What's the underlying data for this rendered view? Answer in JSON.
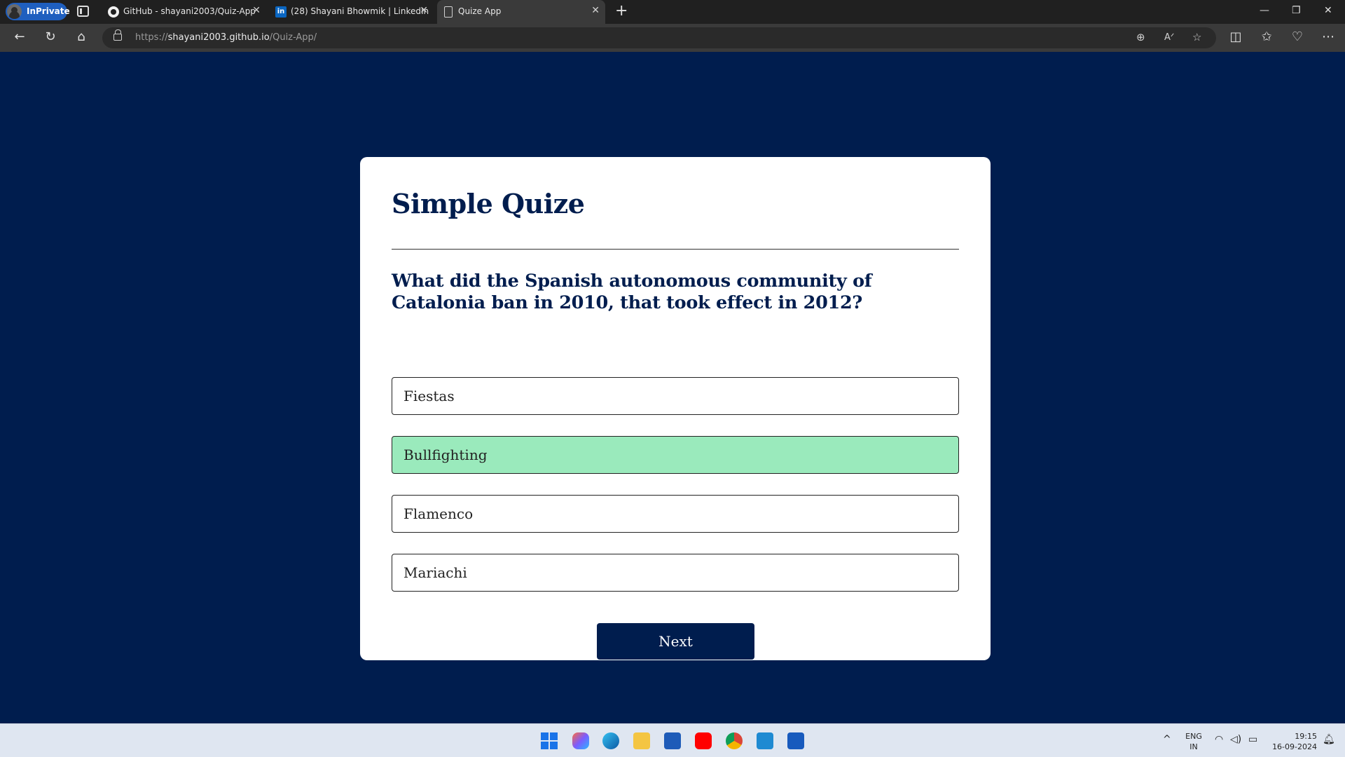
{
  "browser": {
    "inprivate_label": "InPrivate",
    "tabs": [
      {
        "title": "GitHub - shayani2003/Quiz-App",
        "icon": "github-icon"
      },
      {
        "title": "(28) Shayani Bhowmik | LinkedIn",
        "icon": "linkedin-icon",
        "icon_text": "in"
      },
      {
        "title": "Quize App",
        "icon": "page-icon"
      }
    ],
    "url_scheme": "https://",
    "url_host": "shayani2003.github.io",
    "url_path": "/Quiz-App/"
  },
  "quiz": {
    "title": "Simple Quize",
    "question": "What did the Spanish autonomous community of Catalonia ban in 2010, that took effect in 2012?",
    "answers": [
      "Fiestas",
      "Bullfighting",
      "Flamenco",
      "Mariachi"
    ],
    "correct_answer": "Bullfighting",
    "next_label": "Next"
  },
  "colors": {
    "page_background": "#001d4e",
    "card_background": "#ffffff",
    "correct_answer": "#9aeabc",
    "button": "#001d4e"
  },
  "taskbar": {
    "lang_primary": "ENG",
    "lang_secondary": "IN",
    "time": "19:15",
    "date": "16-09-2024",
    "apps": [
      "windows-start-icon",
      "copilot-icon",
      "edge-icon",
      "file-explorer-icon",
      "store-icon",
      "youtube-icon",
      "chrome-icon",
      "vscode-icon",
      "word-icon"
    ]
  }
}
